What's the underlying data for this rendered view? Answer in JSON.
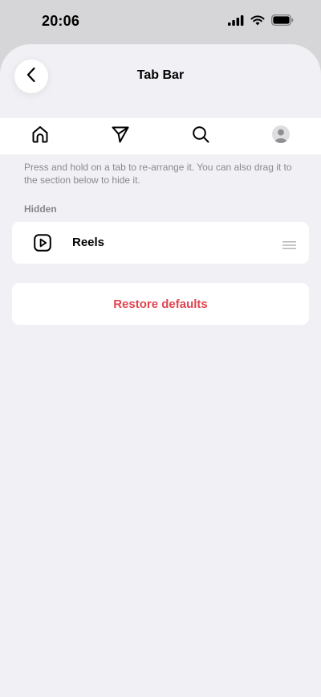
{
  "status_bar": {
    "time": "20:06",
    "icons": [
      "cellular-signal-icon",
      "wifi-icon",
      "battery-icon"
    ]
  },
  "header": {
    "title": "Tab Bar",
    "back_icon": "chevron-left-icon"
  },
  "tab_bar": {
    "tabs": [
      {
        "id": "home",
        "icon": "home-icon"
      },
      {
        "id": "messages",
        "icon": "send-icon"
      },
      {
        "id": "search",
        "icon": "search-icon"
      },
      {
        "id": "profile",
        "icon": "avatar-icon"
      }
    ]
  },
  "instructions": "Press and hold on a tab to re-arrange it. You can also drag it to the section below to hide it.",
  "hidden_section": {
    "label": "Hidden",
    "items": [
      {
        "label": "Reels",
        "icon": "reels-icon"
      }
    ]
  },
  "restore": {
    "label": "Restore defaults",
    "color": "#e0454f"
  },
  "colors": {
    "sheet_background": "#f1f0f5",
    "outer_background": "#d6d6d8",
    "secondary_text": "#8a8a8e"
  }
}
